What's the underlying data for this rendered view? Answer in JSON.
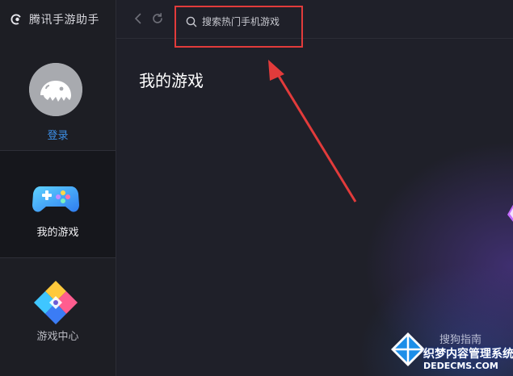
{
  "app": {
    "title": "腾讯手游助手",
    "logo_icon": "tencent-penguin-icon"
  },
  "sidebar": {
    "login_label": "登录",
    "avatar_icon": "default-avatar-icon",
    "items": [
      {
        "label": "我的游戏",
        "icon": "gamepad-icon",
        "active": true
      },
      {
        "label": "游戏中心",
        "icon": "game-center-diamond-icon",
        "active": false
      }
    ]
  },
  "toolbar": {
    "back_icon": "chevron-left-icon",
    "refresh_icon": "refresh-icon",
    "search": {
      "placeholder": "搜索热门手机游戏",
      "value": ""
    }
  },
  "main": {
    "title": "我的游戏"
  },
  "watermarks": {
    "sogou": "搜狗指南",
    "site_title": "织梦内容管理系统",
    "site_url": "DEDECMS.COM"
  },
  "colors": {
    "accent_blue": "#3d8fe6",
    "highlight_red": "#e23b3b",
    "sidebar_bg": "#1d1e24",
    "main_bg": "#1f2029"
  }
}
